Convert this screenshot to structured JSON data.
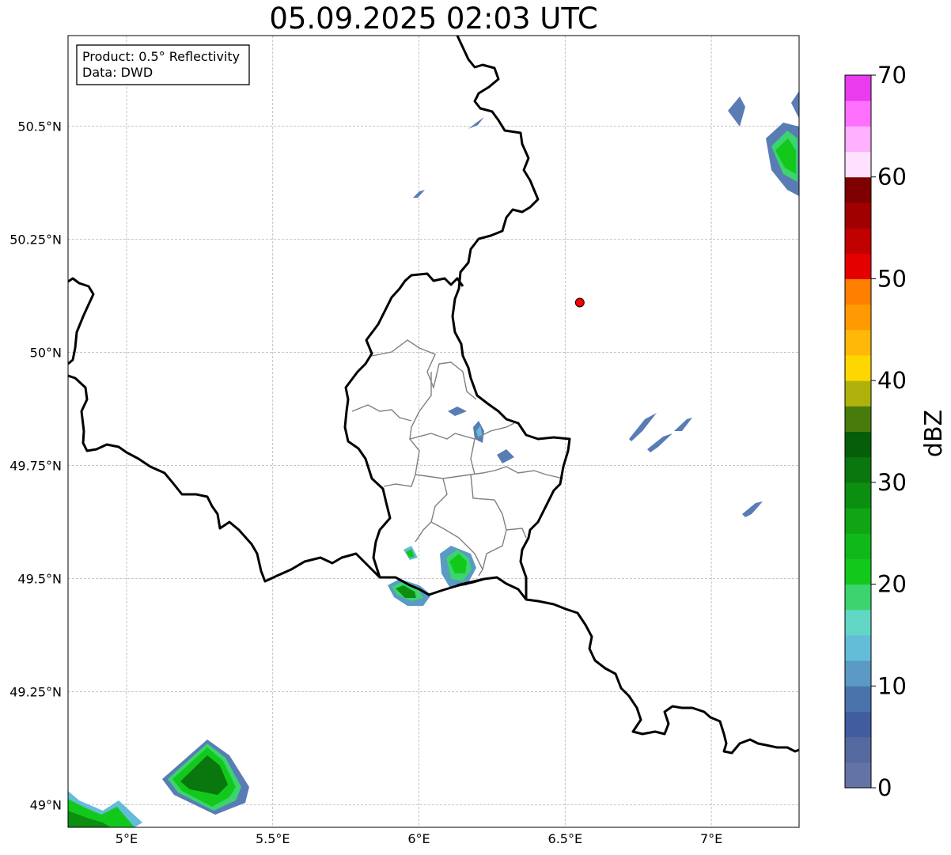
{
  "title": "05.09.2025 02:03 UTC",
  "info_box": {
    "product": "Product: 0.5° Reflectivity",
    "data": "Data: DWD"
  },
  "axes": {
    "lon_range": [
      4.8,
      7.3
    ],
    "lat_range": [
      48.95,
      50.7
    ],
    "lon_ticks": [
      {
        "value": 5.0,
        "label": "5°E"
      },
      {
        "value": 5.5,
        "label": "5.5°E"
      },
      {
        "value": 6.0,
        "label": "6°E"
      },
      {
        "value": 6.5,
        "label": "6.5°E"
      },
      {
        "value": 7.0,
        "label": "7°E"
      }
    ],
    "lat_ticks": [
      {
        "value": 49.0,
        "label": "49°N"
      },
      {
        "value": 49.25,
        "label": "49.25°N"
      },
      {
        "value": 49.5,
        "label": "49.5°N"
      },
      {
        "value": 49.75,
        "label": "49.75°N"
      },
      {
        "value": 50.0,
        "label": "50°N"
      },
      {
        "value": 50.25,
        "label": "50.25°N"
      },
      {
        "value": 50.5,
        "label": "50.5°N"
      }
    ],
    "gridlines": true
  },
  "marker": {
    "lon": 6.55,
    "lat": 50.11,
    "color": "#ff0000"
  },
  "colorbar": {
    "label": "dBZ",
    "range": [
      0,
      70
    ],
    "ticks": [
      {
        "value": 0,
        "label": "0"
      },
      {
        "value": 10,
        "label": "10"
      },
      {
        "value": 20,
        "label": "20"
      },
      {
        "value": 30,
        "label": "30"
      },
      {
        "value": 40,
        "label": "40"
      },
      {
        "value": 50,
        "label": "50"
      },
      {
        "value": 60,
        "label": "60"
      },
      {
        "value": 70,
        "label": "70"
      }
    ],
    "colors": [
      "#6473a6",
      "#5569a0",
      "#425d9f",
      "#4a73ac",
      "#5a9ac5",
      "#63bcd8",
      "#62d6c4",
      "#3bd46e",
      "#12c91b",
      "#11b81a",
      "#0fa514",
      "#0c8e11",
      "#0a760e",
      "#065e08",
      "#497a0c",
      "#aeb20b",
      "#ffd700",
      "#ffb808",
      "#ff9a03",
      "#ff7f00",
      "#e50000",
      "#c10000",
      "#a00000",
      "#7e0000",
      "#ffe0ff",
      "#ffb0ff",
      "#ff70ff",
      "#e83cee"
    ]
  },
  "radar_echoes": [
    {
      "name": "top-right-cluster",
      "color": "#5a7cb5",
      "lon": 7.28,
      "lat": 50.45
    },
    {
      "name": "small-north",
      "color": "#5a7cb5",
      "lon": 6.19,
      "lat": 50.52
    },
    {
      "name": "small-mid-north",
      "color": "#5a7cb5",
      "lon": 5.99,
      "lat": 50.35
    },
    {
      "name": "east-streaks",
      "color": "#5a7cb5",
      "lon": 6.8,
      "lat": 49.8
    },
    {
      "name": "east-small",
      "color": "#5a7cb5",
      "lon": 7.14,
      "lat": 49.66
    },
    {
      "name": "lux-center",
      "color": "#5a7cb5",
      "lon": 6.18,
      "lat": 49.83
    },
    {
      "name": "lux-south",
      "color": "#1ec42a",
      "lon": 6.13,
      "lat": 49.52
    },
    {
      "name": "border-south",
      "color": "#1ec42a",
      "lon": 5.95,
      "lat": 49.48
    },
    {
      "name": "southwest-cell",
      "color": "#14b31c",
      "lon": 5.27,
      "lat": 49.06
    },
    {
      "name": "corner-cell",
      "color": "#14b31c",
      "lon": 4.9,
      "lat": 48.98
    }
  ]
}
